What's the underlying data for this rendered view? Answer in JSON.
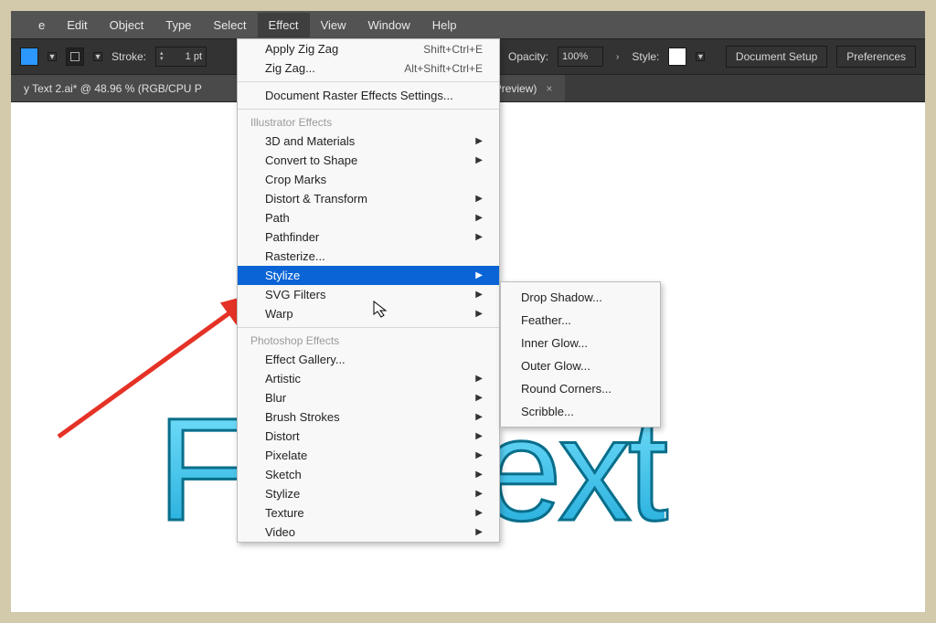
{
  "menubar": {
    "items": [
      "e",
      "Edit",
      "Object",
      "Type",
      "Select",
      "Effect",
      "View",
      "Window",
      "Help"
    ],
    "active_index": 5
  },
  "toolbar": {
    "stroke_label": "Stroke:",
    "stroke_value": "1 pt",
    "opacity_label": "Opacity:",
    "opacity_value": "100%",
    "style_label": "Style:",
    "doc_setup": "Document Setup",
    "preferences": "Preferences"
  },
  "tab": {
    "title_left": "y Text 2.ai* @ 48.96 % (RGB/CPU P",
    "title_right": "PU Preview)"
  },
  "canvas": {
    "text_left": "F",
    "text_right": "ext"
  },
  "menu": {
    "apply": {
      "label": "Apply Zig Zag",
      "shortcut": "Shift+Ctrl+E"
    },
    "last": {
      "label": "Zig Zag...",
      "shortcut": "Alt+Shift+Ctrl+E"
    },
    "raster": "Document Raster Effects Settings...",
    "header1": "Illustrator Effects",
    "ill": [
      "3D and Materials",
      "Convert to Shape",
      "Crop Marks",
      "Distort & Transform",
      "Path",
      "Pathfinder",
      "Rasterize...",
      "Stylize",
      "SVG Filters",
      "Warp"
    ],
    "ill_has_arrow": [
      true,
      true,
      false,
      true,
      true,
      true,
      false,
      true,
      true,
      true
    ],
    "highlight_index": 7,
    "header2": "Photoshop Effects",
    "ps": [
      "Effect Gallery...",
      "Artistic",
      "Blur",
      "Brush Strokes",
      "Distort",
      "Pixelate",
      "Sketch",
      "Stylize",
      "Texture",
      "Video"
    ],
    "ps_has_arrow": [
      false,
      true,
      true,
      true,
      true,
      true,
      true,
      true,
      true,
      true
    ]
  },
  "submenu": {
    "items": [
      "Drop Shadow...",
      "Feather...",
      "Inner Glow...",
      "Outer Glow...",
      "Round Corners...",
      "Scribble..."
    ]
  }
}
